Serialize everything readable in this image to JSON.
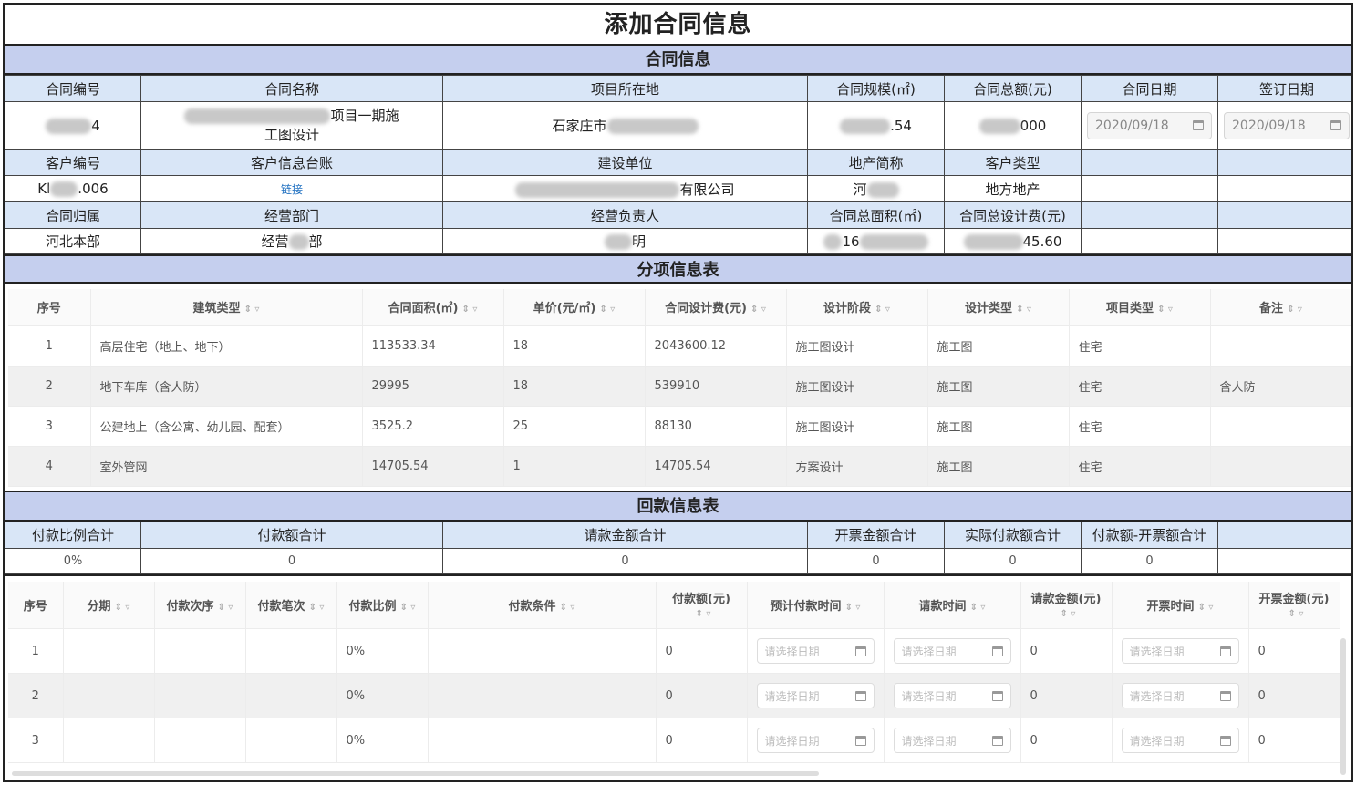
{
  "page_title": "添加合同信息",
  "contract_section": {
    "title": "合同信息",
    "row1_headers": [
      "合同编号",
      "合同名称",
      "项目所在地",
      "合同规模(㎡)",
      "合同总额(元)",
      "合同日期",
      "签订日期"
    ],
    "contract_no_partial": "4",
    "contract_name_partial": "项目一期施",
    "contract_name_line2": "工图设计",
    "location_partial": "石家庄市",
    "scale_partial": ".54",
    "amount_partial": "000",
    "contract_date": "2020/09/18",
    "sign_date": "2020/09/18",
    "row2_headers": [
      "客户编号",
      "客户信息台账",
      "建设单位",
      "地产简称",
      "客户类型"
    ],
    "customer_no_prefix": "Kl",
    "customer_no_suffix": ".006",
    "customer_ledger_link": "链接",
    "builder_partial": "有限公司",
    "realty_short_partial": "河",
    "customer_type": "地方地产",
    "row3_headers": [
      "合同归属",
      "经营部门",
      "经营负责人",
      "合同总面积(㎡)",
      "合同总设计费(元)"
    ],
    "contract_owner": "河北本部",
    "dept_prefix": "经营",
    "dept_suffix": "部",
    "manager_partial": "明",
    "total_area_partial": "16",
    "total_fee_partial": "45.60"
  },
  "items_section": {
    "title": "分项信息表",
    "columns": [
      "序号",
      "建筑类型",
      "合同面积(㎡)",
      "单价(元/㎡)",
      "合同设计费(元)",
      "设计阶段",
      "设计类型",
      "项目类型",
      "备注"
    ],
    "rows": [
      [
        "1",
        "高层住宅（地上、地下）",
        "113533.34",
        "18",
        "2043600.12",
        "施工图设计",
        "施工图",
        "住宅",
        ""
      ],
      [
        "2",
        "地下车库（含人防）",
        "29995",
        "18",
        "539910",
        "施工图设计",
        "施工图",
        "住宅",
        "含人防"
      ],
      [
        "3",
        "公建地上（含公寓、幼儿园、配套）",
        "3525.2",
        "25",
        "88130",
        "施工图设计",
        "施工图",
        "住宅",
        ""
      ],
      [
        "4",
        "室外管网",
        "14705.54",
        "1",
        "14705.54",
        "方案设计",
        "施工图",
        "住宅",
        ""
      ]
    ]
  },
  "payment_section": {
    "title": "回款信息表",
    "summary_headers": [
      "付款比例合计",
      "付款额合计",
      "请款金额合计",
      "开票金额合计",
      "实际付款额合计",
      "付款额-开票额合计"
    ],
    "summary_values": [
      "0%",
      "0",
      "0",
      "0",
      "0",
      "0"
    ],
    "columns": [
      "序号",
      "分期",
      "付款次序",
      "付款笔次",
      "付款比例",
      "付款条件",
      "付款额(元)",
      "预计付款时间",
      "请款时间",
      "请款金额(元)",
      "开票时间",
      "开票金额(元)"
    ],
    "date_placeholder": "请选择日期",
    "rows": [
      {
        "no": "1",
        "ratio": "0%",
        "amount": "0",
        "request_amount": "0",
        "invoice_amount": "0"
      },
      {
        "no": "2",
        "ratio": "0%",
        "amount": "0",
        "request_amount": "0",
        "invoice_amount": "0"
      },
      {
        "no": "3",
        "ratio": "0%",
        "amount": "0",
        "request_amount": "0",
        "invoice_amount": "0"
      }
    ]
  },
  "colors": {
    "section_bg": "#c5cfee",
    "header_bg": "#d9e6f7",
    "border": "#222222",
    "link": "#1e6fc0"
  },
  "icons": {
    "sort": "sort-icon",
    "filter": "filter-icon",
    "date": "calendar-icon"
  }
}
